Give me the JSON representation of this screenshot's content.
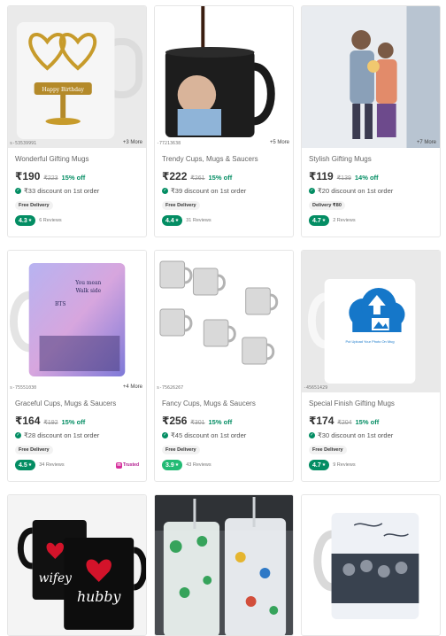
{
  "products": [
    {
      "title": "Wonderful Gifting Mugs",
      "price": "₹190",
      "mrp": "₹223",
      "off": "15% off",
      "discount": "₹33 discount on 1st order",
      "delivery": "Free Delivery",
      "rating": "4.3",
      "reviews": "6 Reviews",
      "more": "+3 More",
      "sku": "s-53539991",
      "rating_color": "#038d63"
    },
    {
      "title": "Trendy Cups, Mugs & Saucers",
      "price": "₹222",
      "mrp": "₹261",
      "off": "15% off",
      "discount": "₹39 discount on 1st order",
      "delivery": "Free Delivery",
      "rating": "4.4",
      "reviews": "31 Reviews",
      "more": "+5 More",
      "sku": "-77213638",
      "rating_color": "#038d63"
    },
    {
      "title": "Stylish Gifting Mugs",
      "price": "₹119",
      "mrp": "₹139",
      "off": "14% off",
      "discount": "₹20 discount on 1st order",
      "delivery": "Delivery ₹80",
      "rating": "4.7",
      "reviews": "2 Reviews",
      "more": "+7 More",
      "sku": "",
      "rating_color": "#038d63"
    },
    {
      "title": "Graceful Cups, Mugs & Saucers",
      "price": "₹164",
      "mrp": "₹192",
      "off": "15% off",
      "discount": "₹28 discount on 1st order",
      "delivery": "Free Delivery",
      "rating": "4.5",
      "reviews": "34 Reviews",
      "more": "+4 More",
      "sku": "s-75551030",
      "rating_color": "#038d63",
      "mall": "Trusted"
    },
    {
      "title": "Fancy Cups, Mugs & Saucers",
      "price": "₹256",
      "mrp": "₹301",
      "off": "15% off",
      "discount": "₹45 discount on 1st order",
      "delivery": "Free Delivery",
      "rating": "3.9",
      "reviews": "43 Reviews",
      "more": "",
      "sku": "s-75626267",
      "rating_color": "#23bb75"
    },
    {
      "title": "Special Finish Gifting Mugs",
      "price": "₹174",
      "mrp": "₹204",
      "off": "15% off",
      "discount": "₹30 discount on 1st order",
      "delivery": "Free Delivery",
      "rating": "4.7",
      "reviews": "9 Reviews",
      "more": "",
      "sku": "-45651429",
      "rating_color": "#038d63"
    },
    {
      "title": "",
      "price": "",
      "mrp": "",
      "off": "",
      "discount": "",
      "delivery": "",
      "rating": "",
      "reviews": "",
      "more": "",
      "sku": ""
    },
    {
      "title": "",
      "price": "",
      "mrp": "",
      "off": "",
      "discount": "",
      "delivery": "",
      "rating": "",
      "reviews": "",
      "more": "",
      "sku": ""
    },
    {
      "title": "",
      "price": "",
      "mrp": "",
      "off": "",
      "discount": "",
      "delivery": "",
      "rating": "",
      "reviews": "",
      "more": "",
      "sku": ""
    }
  ],
  "images": {
    "p0": {
      "mug_text": "Happy Birthday"
    },
    "p3": {
      "mug_text_1": "You mean",
      "mug_text_2": "Walk side",
      "mug_text_3": "BTS"
    },
    "p5": {
      "banner": "Put Upload Your Photo On Mug"
    },
    "p6": {
      "left_text": "wifey",
      "right_text": "hubby"
    }
  }
}
